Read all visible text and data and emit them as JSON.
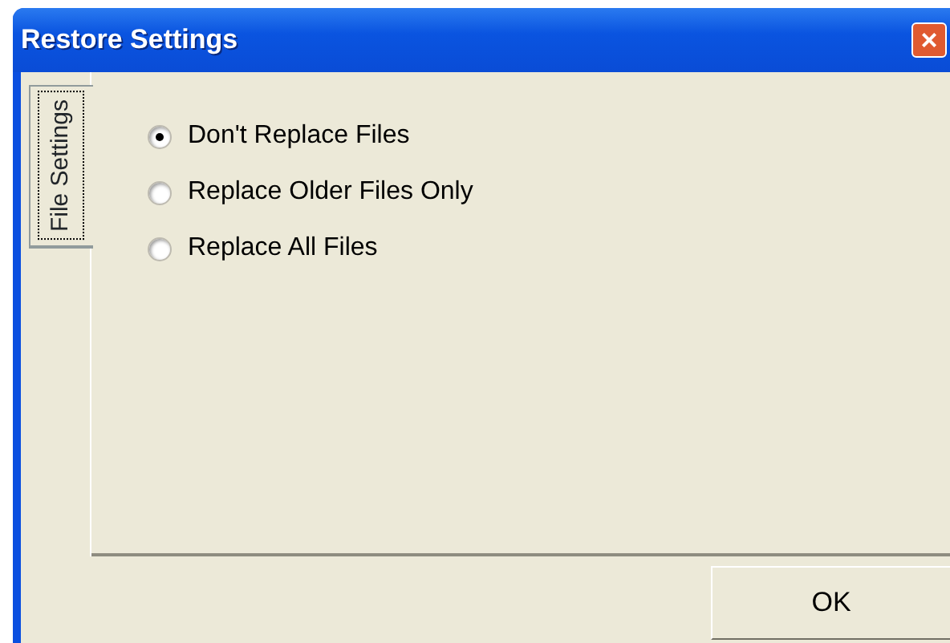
{
  "window": {
    "title": "Restore Settings",
    "close": "×"
  },
  "tabs": [
    {
      "label": "File Settings",
      "selected": true
    }
  ],
  "options": [
    {
      "label": "Don't Replace Files",
      "selected": true
    },
    {
      "label": "Replace Older Files Only",
      "selected": false
    },
    {
      "label": "Replace All Files",
      "selected": false
    }
  ],
  "buttons": [
    "OK"
  ]
}
